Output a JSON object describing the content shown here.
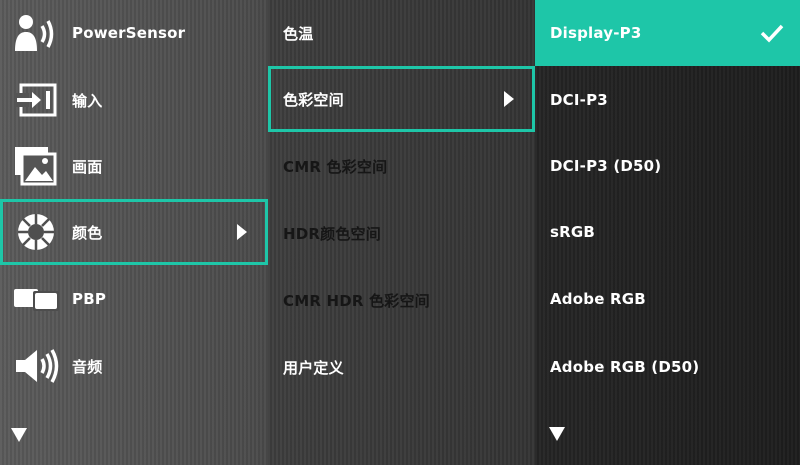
{
  "main_menu": {
    "items": [
      {
        "label": "PowerSensor",
        "icon": "powersensor-icon"
      },
      {
        "label": "输入",
        "icon": "input-icon"
      },
      {
        "label": "画面",
        "icon": "picture-icon"
      },
      {
        "label": "颜色",
        "icon": "color-icon",
        "selected": true
      },
      {
        "label": "PBP",
        "icon": "pbp-icon"
      },
      {
        "label": "音频",
        "icon": "audio-icon"
      }
    ],
    "more_icon": "scroll-down-arrow-icon"
  },
  "color_menu": {
    "items": [
      {
        "label": "色温",
        "enabled": true
      },
      {
        "label": "色彩空间",
        "enabled": true,
        "selected": true
      },
      {
        "label": "CMR 色彩空间",
        "enabled": false
      },
      {
        "label": "HDR颜色空间",
        "enabled": false
      },
      {
        "label": "CMR HDR 色彩空间",
        "enabled": false
      },
      {
        "label": "用户定义",
        "enabled": true
      }
    ]
  },
  "colorspace_menu": {
    "items": [
      {
        "label": "Display-P3",
        "active": true
      },
      {
        "label": "DCI-P3"
      },
      {
        "label": "DCI-P3 (D50)"
      },
      {
        "label": "sRGB"
      },
      {
        "label": "Adobe RGB"
      },
      {
        "label": "Adobe RGB (D50)"
      }
    ],
    "more_icon": "scroll-down-arrow-icon"
  },
  "colors": {
    "accent": "#1ec6a8",
    "text": "#ffffff",
    "disabled_text": "#161616"
  }
}
